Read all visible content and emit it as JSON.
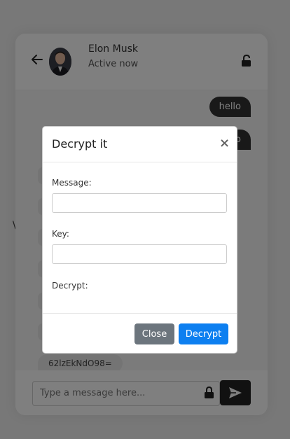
{
  "background": {
    "stray_glyph": "\\"
  },
  "header": {
    "user_name": "Elon Musk",
    "status": "Active now"
  },
  "messages": {
    "outgoing": [
      "hello",
      "o"
    ],
    "incoming_last": "62lzEkNdO98="
  },
  "composer": {
    "placeholder": "Type a message here..."
  },
  "modal": {
    "title": "Decrypt it",
    "close_x": "×",
    "message_label": "Message:",
    "key_label": "Key:",
    "decrypt_label": "Decrypt:",
    "close_button": "Close",
    "decrypt_button": "Decrypt"
  },
  "colors": {
    "primary": "#0d7ff0",
    "secondary": "#6c757d",
    "dark": "#222222"
  }
}
